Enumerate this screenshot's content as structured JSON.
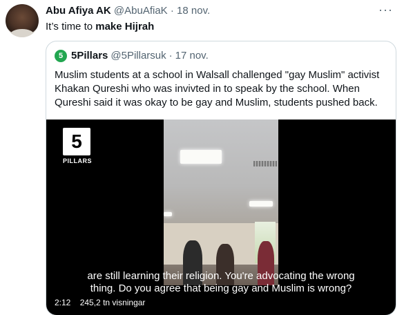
{
  "tweet": {
    "author_name": "Abu Afiya AK",
    "author_handle": "@AbuAfiaK",
    "separator": "·",
    "date": "18 nov.",
    "more_icon": "more-horizontal-icon",
    "text_prefix": "It’s time to ",
    "text_bold": "make Hijrah"
  },
  "quote": {
    "logo_char": "5",
    "author_name": "5Pillars",
    "author_handle": "@5Pillarsuk",
    "separator": "·",
    "date": "17 nov.",
    "text": "Muslim students at a school in Walsall challenged \"gay Muslim\" activist Khakan Qureshi who was invivted in to speak by the school. When Qureshi said it was okay to be gay and Muslim, students pushed back.",
    "video": {
      "brand_number": "5",
      "brand_label": "PILLARS",
      "caption": "are still learning their religion. You're advocating the wrong thing. Do you agree that being gay and Muslim is wrong?",
      "duration": "2:12",
      "views": "245,2 tn visningar"
    }
  }
}
